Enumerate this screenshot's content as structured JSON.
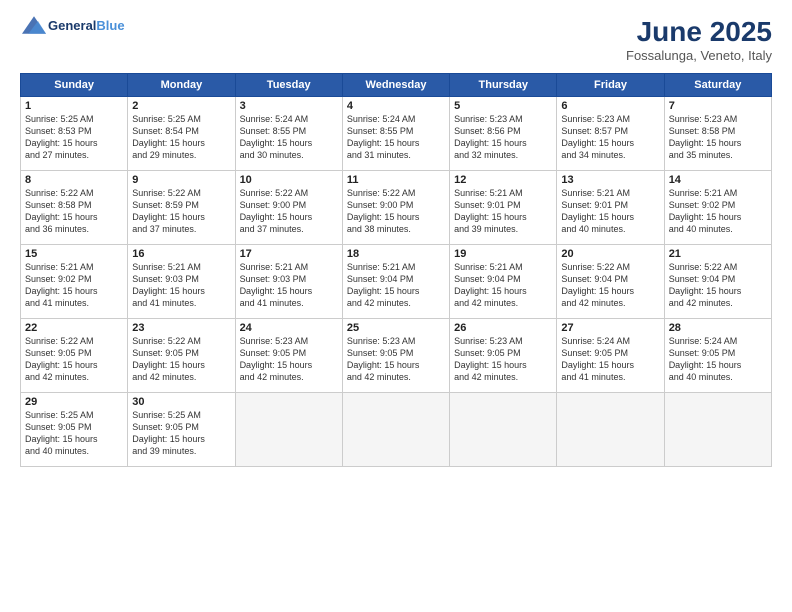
{
  "logo": {
    "text_general": "General",
    "text_blue": "Blue"
  },
  "header": {
    "title": "June 2025",
    "subtitle": "Fossalunga, Veneto, Italy"
  },
  "columns": [
    "Sunday",
    "Monday",
    "Tuesday",
    "Wednesday",
    "Thursday",
    "Friday",
    "Saturday"
  ],
  "weeks": [
    [
      {
        "day": "1",
        "sunrise": "Sunrise: 5:25 AM",
        "sunset": "Sunset: 8:53 PM",
        "daylight": "Daylight: 15 hours",
        "minutes": "and 27 minutes."
      },
      {
        "day": "2",
        "sunrise": "Sunrise: 5:25 AM",
        "sunset": "Sunset: 8:54 PM",
        "daylight": "Daylight: 15 hours",
        "minutes": "and 29 minutes."
      },
      {
        "day": "3",
        "sunrise": "Sunrise: 5:24 AM",
        "sunset": "Sunset: 8:55 PM",
        "daylight": "Daylight: 15 hours",
        "minutes": "and 30 minutes."
      },
      {
        "day": "4",
        "sunrise": "Sunrise: 5:24 AM",
        "sunset": "Sunset: 8:55 PM",
        "daylight": "Daylight: 15 hours",
        "minutes": "and 31 minutes."
      },
      {
        "day": "5",
        "sunrise": "Sunrise: 5:23 AM",
        "sunset": "Sunset: 8:56 PM",
        "daylight": "Daylight: 15 hours",
        "minutes": "and 32 minutes."
      },
      {
        "day": "6",
        "sunrise": "Sunrise: 5:23 AM",
        "sunset": "Sunset: 8:57 PM",
        "daylight": "Daylight: 15 hours",
        "minutes": "and 34 minutes."
      },
      {
        "day": "7",
        "sunrise": "Sunrise: 5:23 AM",
        "sunset": "Sunset: 8:58 PM",
        "daylight": "Daylight: 15 hours",
        "minutes": "and 35 minutes."
      }
    ],
    [
      {
        "day": "8",
        "sunrise": "Sunrise: 5:22 AM",
        "sunset": "Sunset: 8:58 PM",
        "daylight": "Daylight: 15 hours",
        "minutes": "and 36 minutes."
      },
      {
        "day": "9",
        "sunrise": "Sunrise: 5:22 AM",
        "sunset": "Sunset: 8:59 PM",
        "daylight": "Daylight: 15 hours",
        "minutes": "and 37 minutes."
      },
      {
        "day": "10",
        "sunrise": "Sunrise: 5:22 AM",
        "sunset": "Sunset: 9:00 PM",
        "daylight": "Daylight: 15 hours",
        "minutes": "and 37 minutes."
      },
      {
        "day": "11",
        "sunrise": "Sunrise: 5:22 AM",
        "sunset": "Sunset: 9:00 PM",
        "daylight": "Daylight: 15 hours",
        "minutes": "and 38 minutes."
      },
      {
        "day": "12",
        "sunrise": "Sunrise: 5:21 AM",
        "sunset": "Sunset: 9:01 PM",
        "daylight": "Daylight: 15 hours",
        "minutes": "and 39 minutes."
      },
      {
        "day": "13",
        "sunrise": "Sunrise: 5:21 AM",
        "sunset": "Sunset: 9:01 PM",
        "daylight": "Daylight: 15 hours",
        "minutes": "and 40 minutes."
      },
      {
        "day": "14",
        "sunrise": "Sunrise: 5:21 AM",
        "sunset": "Sunset: 9:02 PM",
        "daylight": "Daylight: 15 hours",
        "minutes": "and 40 minutes."
      }
    ],
    [
      {
        "day": "15",
        "sunrise": "Sunrise: 5:21 AM",
        "sunset": "Sunset: 9:02 PM",
        "daylight": "Daylight: 15 hours",
        "minutes": "and 41 minutes."
      },
      {
        "day": "16",
        "sunrise": "Sunrise: 5:21 AM",
        "sunset": "Sunset: 9:03 PM",
        "daylight": "Daylight: 15 hours",
        "minutes": "and 41 minutes."
      },
      {
        "day": "17",
        "sunrise": "Sunrise: 5:21 AM",
        "sunset": "Sunset: 9:03 PM",
        "daylight": "Daylight: 15 hours",
        "minutes": "and 41 minutes."
      },
      {
        "day": "18",
        "sunrise": "Sunrise: 5:21 AM",
        "sunset": "Sunset: 9:04 PM",
        "daylight": "Daylight: 15 hours",
        "minutes": "and 42 minutes."
      },
      {
        "day": "19",
        "sunrise": "Sunrise: 5:21 AM",
        "sunset": "Sunset: 9:04 PM",
        "daylight": "Daylight: 15 hours",
        "minutes": "and 42 minutes."
      },
      {
        "day": "20",
        "sunrise": "Sunrise: 5:22 AM",
        "sunset": "Sunset: 9:04 PM",
        "daylight": "Daylight: 15 hours",
        "minutes": "and 42 minutes."
      },
      {
        "day": "21",
        "sunrise": "Sunrise: 5:22 AM",
        "sunset": "Sunset: 9:04 PM",
        "daylight": "Daylight: 15 hours",
        "minutes": "and 42 minutes."
      }
    ],
    [
      {
        "day": "22",
        "sunrise": "Sunrise: 5:22 AM",
        "sunset": "Sunset: 9:05 PM",
        "daylight": "Daylight: 15 hours",
        "minutes": "and 42 minutes."
      },
      {
        "day": "23",
        "sunrise": "Sunrise: 5:22 AM",
        "sunset": "Sunset: 9:05 PM",
        "daylight": "Daylight: 15 hours",
        "minutes": "and 42 minutes."
      },
      {
        "day": "24",
        "sunrise": "Sunrise: 5:23 AM",
        "sunset": "Sunset: 9:05 PM",
        "daylight": "Daylight: 15 hours",
        "minutes": "and 42 minutes."
      },
      {
        "day": "25",
        "sunrise": "Sunrise: 5:23 AM",
        "sunset": "Sunset: 9:05 PM",
        "daylight": "Daylight: 15 hours",
        "minutes": "and 42 minutes."
      },
      {
        "day": "26",
        "sunrise": "Sunrise: 5:23 AM",
        "sunset": "Sunset: 9:05 PM",
        "daylight": "Daylight: 15 hours",
        "minutes": "and 42 minutes."
      },
      {
        "day": "27",
        "sunrise": "Sunrise: 5:24 AM",
        "sunset": "Sunset: 9:05 PM",
        "daylight": "Daylight: 15 hours",
        "minutes": "and 41 minutes."
      },
      {
        "day": "28",
        "sunrise": "Sunrise: 5:24 AM",
        "sunset": "Sunset: 9:05 PM",
        "daylight": "Daylight: 15 hours",
        "minutes": "and 40 minutes."
      }
    ],
    [
      {
        "day": "29",
        "sunrise": "Sunrise: 5:25 AM",
        "sunset": "Sunset: 9:05 PM",
        "daylight": "Daylight: 15 hours",
        "minutes": "and 40 minutes."
      },
      {
        "day": "30",
        "sunrise": "Sunrise: 5:25 AM",
        "sunset": "Sunset: 9:05 PM",
        "daylight": "Daylight: 15 hours",
        "minutes": "and 39 minutes."
      },
      null,
      null,
      null,
      null,
      null
    ]
  ]
}
